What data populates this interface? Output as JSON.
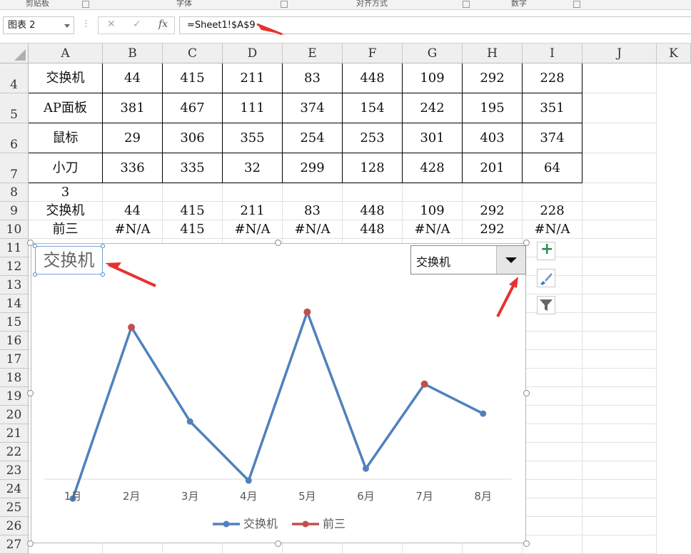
{
  "ribbon": {
    "groups": [
      {
        "label": "剪贴板"
      },
      {
        "label": "字体"
      },
      {
        "label": "对齐方式"
      },
      {
        "label": "数字"
      }
    ]
  },
  "formula_bar": {
    "name_box": "图表 2",
    "cancel_icon": "✕",
    "enter_icon": "✓",
    "fx_label": "fx",
    "formula": "=Sheet1!$A$9"
  },
  "columns": [
    "A",
    "B",
    "C",
    "D",
    "E",
    "F",
    "G",
    "H",
    "I",
    "J",
    "K"
  ],
  "rows": [
    {
      "num": "4",
      "cells": [
        "交换机",
        "44",
        "415",
        "211",
        "83",
        "448",
        "109",
        "292",
        "228"
      ]
    },
    {
      "num": "5",
      "cells": [
        "AP面板",
        "381",
        "467",
        "111",
        "374",
        "154",
        "242",
        "195",
        "351"
      ]
    },
    {
      "num": "6",
      "cells": [
        "鼠标",
        "29",
        "306",
        "355",
        "254",
        "253",
        "301",
        "403",
        "374"
      ]
    },
    {
      "num": "7",
      "cells": [
        "小刀",
        "336",
        "335",
        "32",
        "299",
        "128",
        "428",
        "201",
        "64"
      ]
    },
    {
      "num": "8",
      "cells": [
        "3",
        "",
        "",
        "",
        "",
        "",
        "",
        "",
        ""
      ]
    },
    {
      "num": "9",
      "cells": [
        "交换机",
        "44",
        "415",
        "211",
        "83",
        "448",
        "109",
        "292",
        "228"
      ]
    },
    {
      "num": "10",
      "cells": [
        "前三",
        "#N/A",
        "415",
        "#N/A",
        "#N/A",
        "448",
        "#N/A",
        "292",
        "#N/A"
      ]
    }
  ],
  "extra_rows": [
    "11",
    "12",
    "13",
    "14",
    "15",
    "16",
    "17",
    "18",
    "19",
    "20",
    "21",
    "22",
    "23",
    "24",
    "25",
    "26",
    "27"
  ],
  "combo": {
    "selected": "交换机"
  },
  "side_buttons": [
    {
      "icon": "plus-icon",
      "glyph": "+"
    },
    {
      "icon": "brush-icon"
    },
    {
      "icon": "filter-icon"
    }
  ],
  "colors": {
    "series1": "#4f81bd",
    "series2": "#c0504d",
    "annotation": "#e8312f"
  },
  "chart_data": {
    "type": "line",
    "title": "交换机",
    "categories": [
      "1月",
      "2月",
      "3月",
      "4月",
      "5月",
      "6月",
      "7月",
      "8月"
    ],
    "series": [
      {
        "name": "交换机",
        "values": [
          44,
          415,
          211,
          83,
          448,
          109,
          292,
          228
        ]
      },
      {
        "name": "前三",
        "values": [
          null,
          415,
          null,
          null,
          448,
          null,
          292,
          null
        ]
      }
    ],
    "ylim": [
      0,
      500
    ],
    "grid": false,
    "legend": "bottom"
  }
}
